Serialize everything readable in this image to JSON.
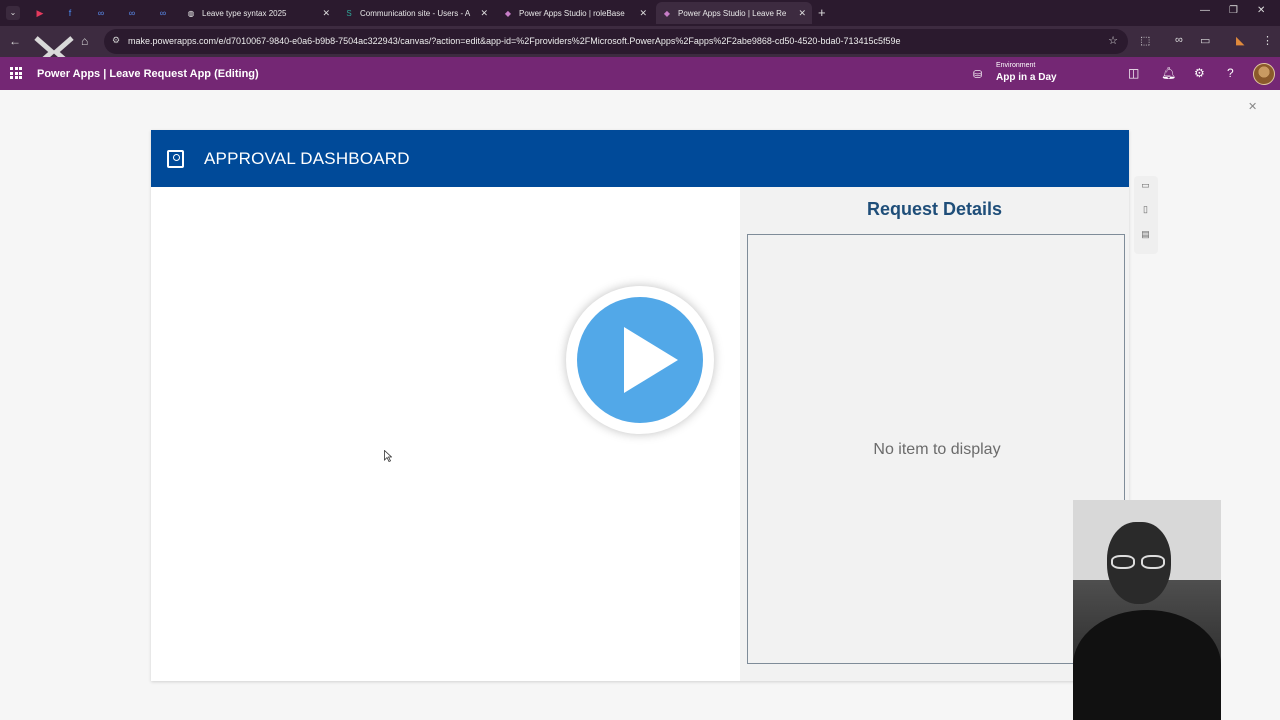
{
  "browser": {
    "tabs": [
      {
        "label": "Leave type syntax 2025",
        "icon": "globe-icon"
      },
      {
        "label": "Communication site - Users - A",
        "icon": "sharepoint-icon"
      },
      {
        "label": "Power Apps Studio | roleBase",
        "icon": "powerapps-icon"
      },
      {
        "label": "Power Apps Studio | Leave Re",
        "icon": "powerapps-icon",
        "active": true
      }
    ],
    "url": "make.powerapps.com/e/d7010067-9840-e0a6-b9b8-7504ac322943/canvas/?action=edit&app-id=%2Fproviders%2FMicrosoft.PowerApps%2Fapps%2F2abe9868-cd50-4520-bda0-713415c5f59e"
  },
  "header": {
    "title": "Power Apps  |  Leave Request App (Editing)",
    "environment_label": "Environment",
    "environment_name": "App in a Day",
    "accent_color": "#742774"
  },
  "app": {
    "banner_title": "APPROVAL DASHBOARD",
    "banner_color": "#004a99",
    "details_title": "Request Details",
    "empty_message": "No item to display"
  }
}
